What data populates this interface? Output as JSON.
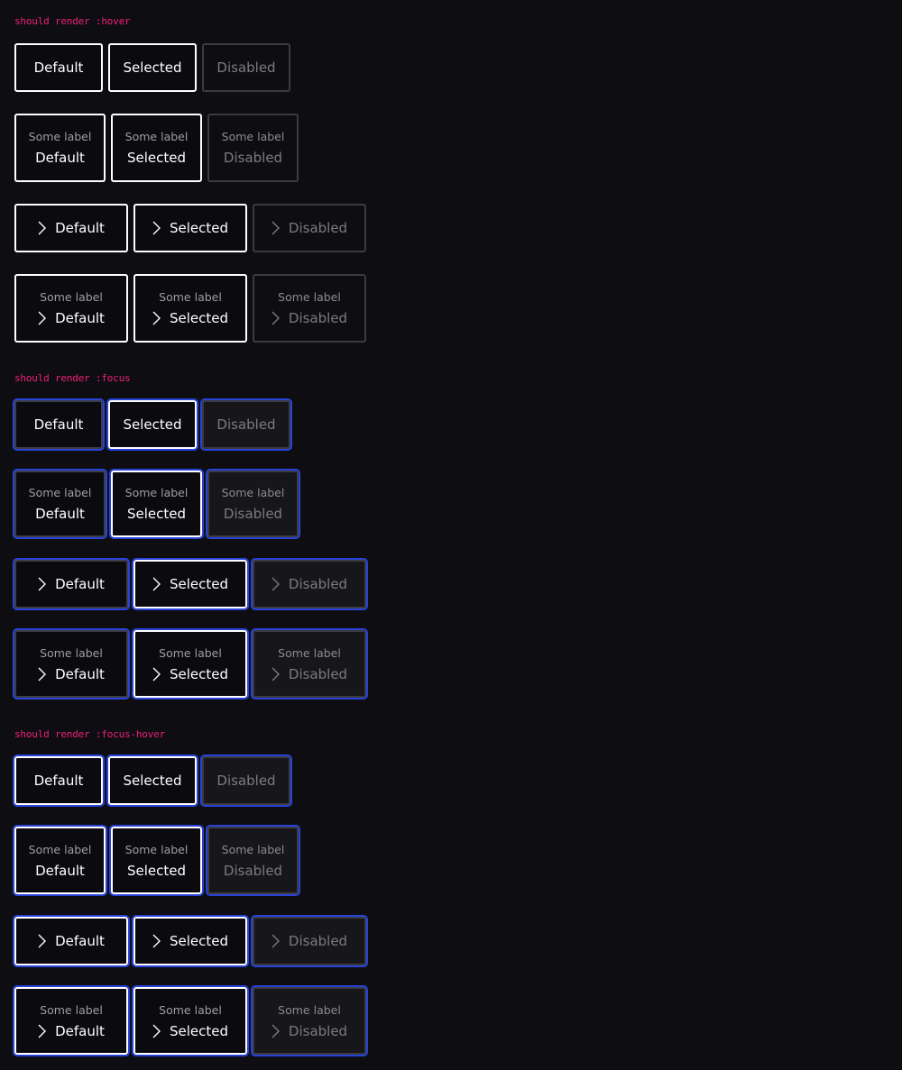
{
  "sections": [
    {
      "title": "should render :hover"
    },
    {
      "title": "should render :focus"
    },
    {
      "title": "should render :focus-hover"
    }
  ],
  "buttons": {
    "default": "Default",
    "selected": "Selected",
    "disabled": "Disabled",
    "sublabel": "Some label"
  },
  "icons": {
    "chevron": "chevron-right-icon"
  },
  "colors": {
    "background": "#0e0e12",
    "section_title": "#f01f7a",
    "focus_ring": "#2843d8",
    "border_active": "#ffffff",
    "border_disabled": "#3b3b40",
    "text_disabled": "#7a7a80"
  }
}
